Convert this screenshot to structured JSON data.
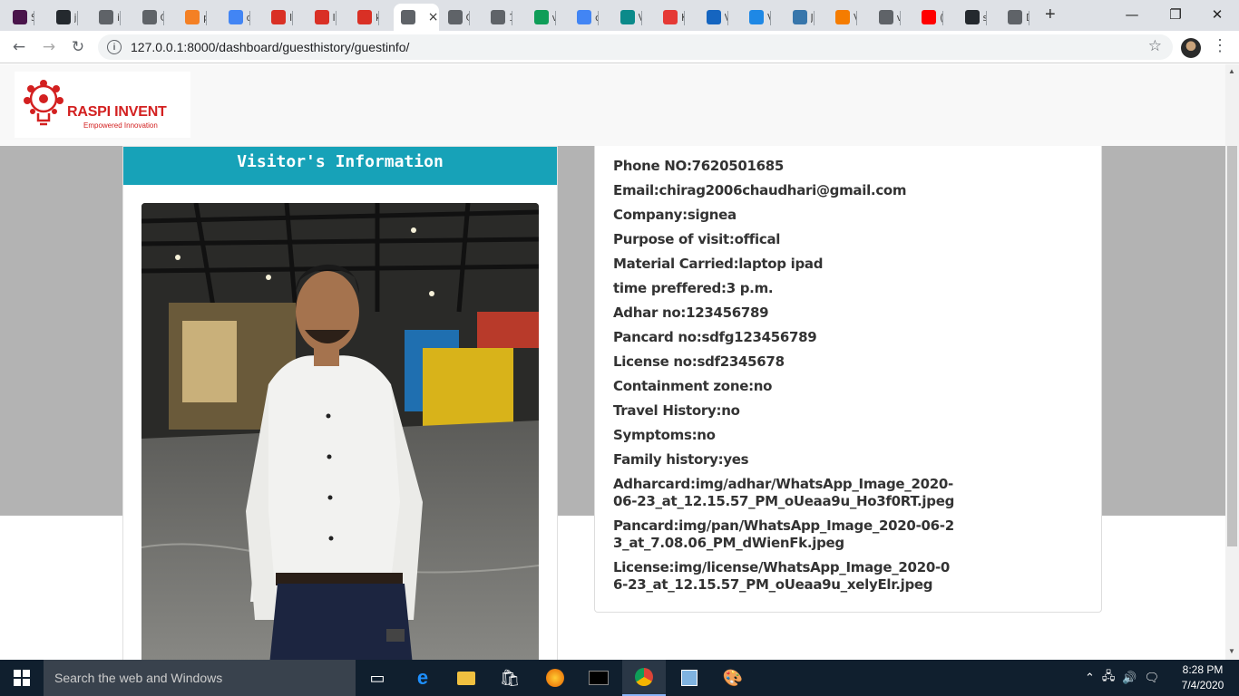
{
  "browser": {
    "tabs": [
      {
        "label": "Sl",
        "icon": "slack-icon",
        "color": "#4a154b"
      },
      {
        "label": "ja",
        "icon": "github-icon",
        "color": "#24292e"
      },
      {
        "label": "in",
        "icon": "globe-icon",
        "color": "#5f6368"
      },
      {
        "label": "G",
        "icon": "globe-icon",
        "color": "#5f6368"
      },
      {
        "label": "p",
        "icon": "stackoverflow-icon",
        "color": "#f48024"
      },
      {
        "label": "dj",
        "icon": "google-icon",
        "color": "#4285f4"
      },
      {
        "label": "Ir",
        "icon": "gmail-icon",
        "color": "#d93025"
      },
      {
        "label": "Ir",
        "icon": "gmail-icon",
        "color": "#d93025"
      },
      {
        "label": "k",
        "icon": "gmail-icon",
        "color": "#d93025"
      },
      {
        "label": "",
        "icon": "globe-icon",
        "color": "#5f6368",
        "active": true
      },
      {
        "label": "C",
        "icon": "globe-icon",
        "color": "#5f6368"
      },
      {
        "label": "1",
        "icon": "globe-icon",
        "color": "#5f6368"
      },
      {
        "label": "vi",
        "icon": "drive-icon",
        "color": "#0f9d58"
      },
      {
        "label": "c",
        "icon": "docs-icon",
        "color": "#4285f4"
      },
      {
        "label": "V",
        "icon": "dots-icon",
        "color": "#0b8a8a"
      },
      {
        "label": "K",
        "icon": "q-icon",
        "color": "#e53935"
      },
      {
        "label": "V",
        "icon": "r-icon",
        "color": "#1565c0"
      },
      {
        "label": "V",
        "icon": "send-icon",
        "color": "#1e88e5"
      },
      {
        "label": "Ju",
        "icon": "python-icon",
        "color": "#3776ab"
      },
      {
        "label": "V",
        "icon": "walk-icon",
        "color": "#f57c00"
      },
      {
        "label": "vi",
        "icon": "globe-icon",
        "color": "#5f6368"
      },
      {
        "label": "(€",
        "icon": "youtube-icon",
        "color": "#ff0000"
      },
      {
        "label": "st",
        "icon": "github-icon",
        "color": "#24292e"
      },
      {
        "label": "D",
        "icon": "globe-icon",
        "color": "#5f6368"
      }
    ],
    "new_tab": "+",
    "url": "127.0.0.1:8000/dashboard/guesthistory/guestinfo/"
  },
  "logo": {
    "brand": "RASPI INVENT",
    "tagline": "Empowered Innovation"
  },
  "left_card": {
    "title": "Visitor's Information"
  },
  "info": [
    {
      "label": "Phone NO:",
      "value": "7620501685"
    },
    {
      "label": "Email:",
      "value": "chirag2006chaudhari@gmail.com"
    },
    {
      "label": "Company:",
      "value": "signea"
    },
    {
      "label": "Purpose of visit:",
      "value": "offical"
    },
    {
      "label": "Material Carried:",
      "value": "laptop ipad"
    },
    {
      "label": "time preffered:",
      "value": "3 p.m."
    },
    {
      "label": "Adhar no:",
      "value": "123456789"
    },
    {
      "label": "Pancard no:",
      "value": "sdfg123456789"
    },
    {
      "label": "License no:",
      "value": "sdf2345678"
    },
    {
      "label": "Containment zone:",
      "value": "no"
    },
    {
      "label": "Travel History:",
      "value": "no"
    },
    {
      "label": "Symptoms:",
      "value": "no"
    },
    {
      "label": "Family history:",
      "value": "yes"
    },
    {
      "label": "Adharcard:",
      "value": "img/adhar/WhatsApp_Image_2020-06-23_at_12.15.57_PM_oUeaa9u_Ho3f0RT.jpeg"
    },
    {
      "label": "Pancard:",
      "value": "img/pan/WhatsApp_Image_2020-06-23_at_7.08.06_PM_dWienFk.jpeg"
    },
    {
      "label": "License:",
      "value": "img/license/WhatsApp_Image_2020-06-23_at_12.15.57_PM_oUeaa9u_xelyElr.jpeg"
    }
  ],
  "taskbar": {
    "search_placeholder": "Search the web and Windows",
    "time": "8:28 PM",
    "date": "7/4/2020"
  }
}
